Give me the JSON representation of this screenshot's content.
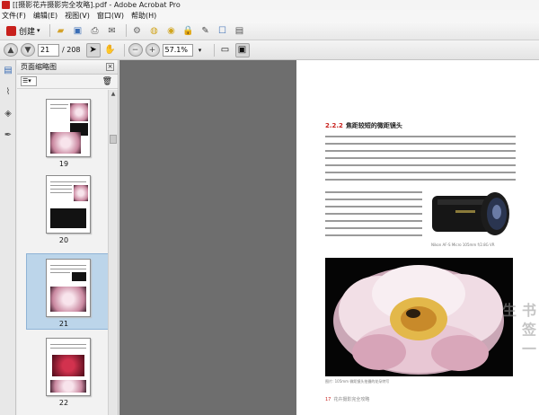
{
  "window": {
    "title": "[[摄影花卉摄影完全攻略].pdf - Adobe Acrobat Pro"
  },
  "menu": [
    "文件(F)",
    "编辑(E)",
    "视图(V)",
    "窗口(W)",
    "帮助(H)"
  ],
  "toolbar": {
    "create_label": "创建",
    "page_current": "21",
    "page_total": "/ 208",
    "zoom_value": "57.1%"
  },
  "panel": {
    "title": "页面缩略图",
    "thumbnails": [
      {
        "label": "19"
      },
      {
        "label": "20"
      },
      {
        "label": "21",
        "selected": true
      },
      {
        "label": "22"
      }
    ]
  },
  "page": {
    "heading_number": "2.2.2",
    "heading_text": "焦距较短的微距镜头",
    "lens_caption": "Nikon AF-S Micro 105mm f/2.8G VR",
    "photo_caption": "图片: 105mm 微距镜头拍摄的花朵特写",
    "footer_number": "17",
    "footer_text": "花卉摄影完全攻略",
    "watermark": "书 签 一 生"
  },
  "colors": {
    "accent_red": "#c8201c",
    "doc_background": "#6e6e6e",
    "thumb_selected": "#bcd5ea"
  }
}
